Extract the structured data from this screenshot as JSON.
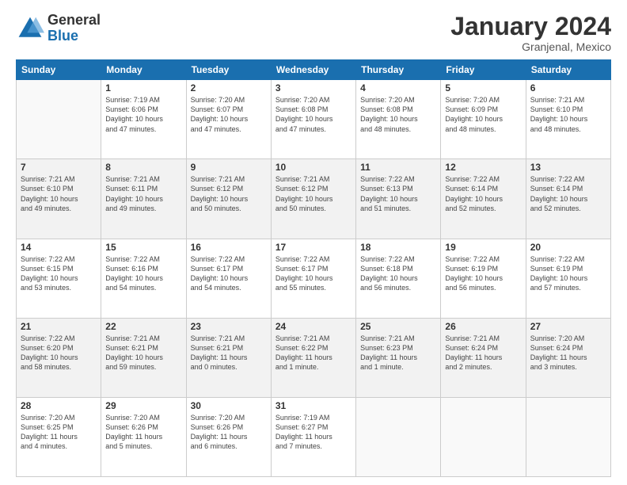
{
  "logo": {
    "general": "General",
    "blue": "Blue"
  },
  "title": {
    "month": "January 2024",
    "location": "Granjenal, Mexico"
  },
  "weekdays": [
    "Sunday",
    "Monday",
    "Tuesday",
    "Wednesday",
    "Thursday",
    "Friday",
    "Saturday"
  ],
  "weeks": [
    [
      {
        "day": "",
        "info": ""
      },
      {
        "day": "1",
        "info": "Sunrise: 7:19 AM\nSunset: 6:06 PM\nDaylight: 10 hours\nand 47 minutes."
      },
      {
        "day": "2",
        "info": "Sunrise: 7:20 AM\nSunset: 6:07 PM\nDaylight: 10 hours\nand 47 minutes."
      },
      {
        "day": "3",
        "info": "Sunrise: 7:20 AM\nSunset: 6:08 PM\nDaylight: 10 hours\nand 47 minutes."
      },
      {
        "day": "4",
        "info": "Sunrise: 7:20 AM\nSunset: 6:08 PM\nDaylight: 10 hours\nand 48 minutes."
      },
      {
        "day": "5",
        "info": "Sunrise: 7:20 AM\nSunset: 6:09 PM\nDaylight: 10 hours\nand 48 minutes."
      },
      {
        "day": "6",
        "info": "Sunrise: 7:21 AM\nSunset: 6:10 PM\nDaylight: 10 hours\nand 48 minutes."
      }
    ],
    [
      {
        "day": "7",
        "info": "Sunrise: 7:21 AM\nSunset: 6:10 PM\nDaylight: 10 hours\nand 49 minutes."
      },
      {
        "day": "8",
        "info": "Sunrise: 7:21 AM\nSunset: 6:11 PM\nDaylight: 10 hours\nand 49 minutes."
      },
      {
        "day": "9",
        "info": "Sunrise: 7:21 AM\nSunset: 6:12 PM\nDaylight: 10 hours\nand 50 minutes."
      },
      {
        "day": "10",
        "info": "Sunrise: 7:21 AM\nSunset: 6:12 PM\nDaylight: 10 hours\nand 50 minutes."
      },
      {
        "day": "11",
        "info": "Sunrise: 7:22 AM\nSunset: 6:13 PM\nDaylight: 10 hours\nand 51 minutes."
      },
      {
        "day": "12",
        "info": "Sunrise: 7:22 AM\nSunset: 6:14 PM\nDaylight: 10 hours\nand 52 minutes."
      },
      {
        "day": "13",
        "info": "Sunrise: 7:22 AM\nSunset: 6:14 PM\nDaylight: 10 hours\nand 52 minutes."
      }
    ],
    [
      {
        "day": "14",
        "info": "Sunrise: 7:22 AM\nSunset: 6:15 PM\nDaylight: 10 hours\nand 53 minutes."
      },
      {
        "day": "15",
        "info": "Sunrise: 7:22 AM\nSunset: 6:16 PM\nDaylight: 10 hours\nand 54 minutes."
      },
      {
        "day": "16",
        "info": "Sunrise: 7:22 AM\nSunset: 6:17 PM\nDaylight: 10 hours\nand 54 minutes."
      },
      {
        "day": "17",
        "info": "Sunrise: 7:22 AM\nSunset: 6:17 PM\nDaylight: 10 hours\nand 55 minutes."
      },
      {
        "day": "18",
        "info": "Sunrise: 7:22 AM\nSunset: 6:18 PM\nDaylight: 10 hours\nand 56 minutes."
      },
      {
        "day": "19",
        "info": "Sunrise: 7:22 AM\nSunset: 6:19 PM\nDaylight: 10 hours\nand 56 minutes."
      },
      {
        "day": "20",
        "info": "Sunrise: 7:22 AM\nSunset: 6:19 PM\nDaylight: 10 hours\nand 57 minutes."
      }
    ],
    [
      {
        "day": "21",
        "info": "Sunrise: 7:22 AM\nSunset: 6:20 PM\nDaylight: 10 hours\nand 58 minutes."
      },
      {
        "day": "22",
        "info": "Sunrise: 7:21 AM\nSunset: 6:21 PM\nDaylight: 10 hours\nand 59 minutes."
      },
      {
        "day": "23",
        "info": "Sunrise: 7:21 AM\nSunset: 6:21 PM\nDaylight: 11 hours\nand 0 minutes."
      },
      {
        "day": "24",
        "info": "Sunrise: 7:21 AM\nSunset: 6:22 PM\nDaylight: 11 hours\nand 1 minute."
      },
      {
        "day": "25",
        "info": "Sunrise: 7:21 AM\nSunset: 6:23 PM\nDaylight: 11 hours\nand 1 minute."
      },
      {
        "day": "26",
        "info": "Sunrise: 7:21 AM\nSunset: 6:24 PM\nDaylight: 11 hours\nand 2 minutes."
      },
      {
        "day": "27",
        "info": "Sunrise: 7:20 AM\nSunset: 6:24 PM\nDaylight: 11 hours\nand 3 minutes."
      }
    ],
    [
      {
        "day": "28",
        "info": "Sunrise: 7:20 AM\nSunset: 6:25 PM\nDaylight: 11 hours\nand 4 minutes."
      },
      {
        "day": "29",
        "info": "Sunrise: 7:20 AM\nSunset: 6:26 PM\nDaylight: 11 hours\nand 5 minutes."
      },
      {
        "day": "30",
        "info": "Sunrise: 7:20 AM\nSunset: 6:26 PM\nDaylight: 11 hours\nand 6 minutes."
      },
      {
        "day": "31",
        "info": "Sunrise: 7:19 AM\nSunset: 6:27 PM\nDaylight: 11 hours\nand 7 minutes."
      },
      {
        "day": "",
        "info": ""
      },
      {
        "day": "",
        "info": ""
      },
      {
        "day": "",
        "info": ""
      }
    ]
  ]
}
